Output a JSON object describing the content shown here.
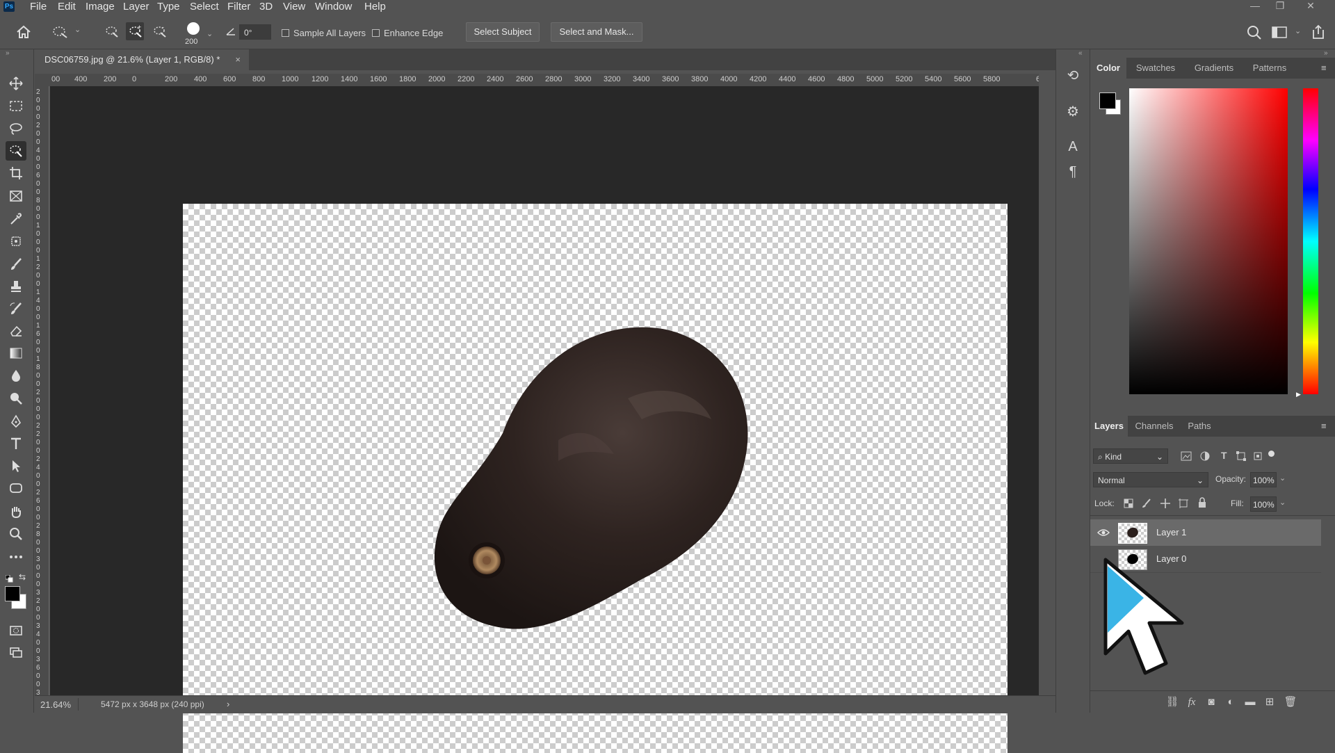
{
  "app": {
    "logo_text": "Ps"
  },
  "menubar": {
    "items": [
      "File",
      "Edit",
      "Image",
      "Layer",
      "Type",
      "Select",
      "Filter",
      "3D",
      "View",
      "Window",
      "Help"
    ]
  },
  "options_bar": {
    "brush_size": "200",
    "angle": "0°",
    "sample_all_layers": "Sample All Layers",
    "enhance_edge": "Enhance Edge",
    "select_subject": "Select Subject",
    "select_and_mask": "Select and Mask..."
  },
  "document_tab": {
    "title": "DSC06759.jpg @ 21.6% (Layer 1, RGB/8) *",
    "close": "×"
  },
  "ruler": {
    "h_ticks": [
      "00",
      "400",
      "200",
      "0",
      "200",
      "400",
      "600",
      "800",
      "1000",
      "1200",
      "1400",
      "1600",
      "1800",
      "2000",
      "2200",
      "2400",
      "2600",
      "2800",
      "3000",
      "3200",
      "3400",
      "3600",
      "3800",
      "4000",
      "4200",
      "4400",
      "4600",
      "4800",
      "5000",
      "5200",
      "5400",
      "5600",
      "5800",
      "6"
    ],
    "v_ticks": [
      "2",
      "0",
      "0",
      "0",
      "2",
      "0",
      "0",
      "4",
      "0",
      "0",
      "6",
      "0",
      "0",
      "8",
      "0",
      "0",
      "1",
      "0",
      "0",
      "0",
      "1",
      "2",
      "0",
      "0",
      "1",
      "4",
      "0",
      "0",
      "1",
      "6",
      "0",
      "0",
      "1",
      "8",
      "0",
      "0",
      "2",
      "0",
      "0",
      "0",
      "2",
      "2",
      "0",
      "0",
      "2",
      "4",
      "0",
      "0",
      "2",
      "6",
      "0",
      "0",
      "2",
      "8",
      "0",
      "0",
      "3",
      "0",
      "0",
      "0",
      "3",
      "2",
      "0",
      "0",
      "3",
      "4",
      "0",
      "0",
      "3",
      "6",
      "0",
      "0",
      "3"
    ]
  },
  "statusbar": {
    "zoom": "21.64%",
    "doc_info": "5472 px x 3648 px (240 ppi)",
    "arrow": "›"
  },
  "color_panel": {
    "tabs": [
      "Color",
      "Swatches",
      "Gradients",
      "Patterns"
    ],
    "active": "Color",
    "fg": "#000000",
    "bg": "#ffffff"
  },
  "layers_panel": {
    "tabs": [
      "Layers",
      "Channels",
      "Paths"
    ],
    "active": "Layers",
    "filter_kind": "Kind",
    "blend_mode": "Normal",
    "opacity_label": "Opacity:",
    "opacity_value": "100%",
    "lock_label": "Lock:",
    "fill_label": "Fill:",
    "fill_value": "100%",
    "layers": [
      {
        "name": "Layer 1",
        "visible": true,
        "selected": true
      },
      {
        "name": "Layer 0",
        "visible": false,
        "selected": false
      }
    ]
  }
}
